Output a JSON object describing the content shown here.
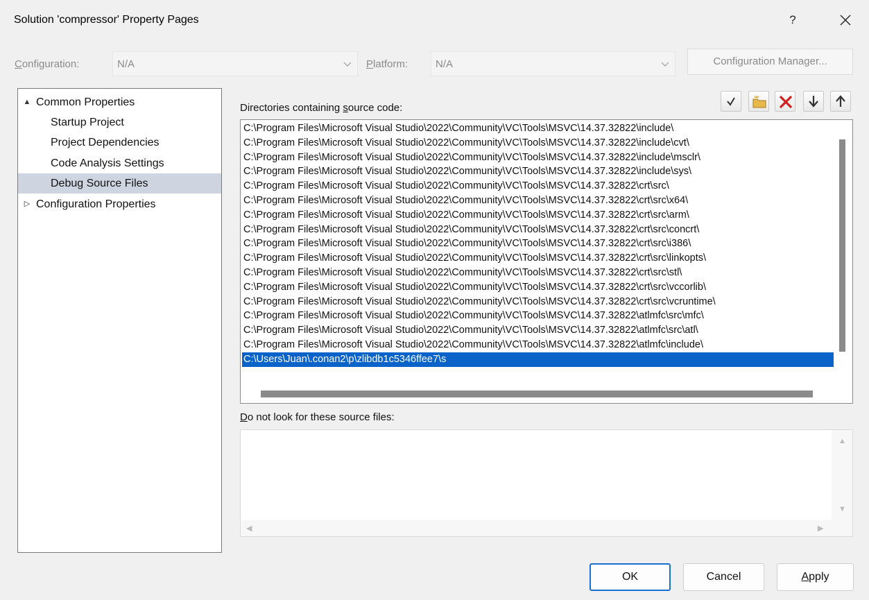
{
  "window": {
    "title": "Solution 'compressor' Property Pages",
    "help_glyph": "?",
    "close_icon": "close-icon"
  },
  "config_bar": {
    "configuration_label_first": "C",
    "configuration_label_rest": "onfiguration:",
    "configuration_value": "N/A",
    "platform_label_first": "P",
    "platform_label_rest": "latform:",
    "platform_value": "N/A",
    "configuration_manager_label": "Configuration Manager..."
  },
  "tree": {
    "items": [
      {
        "label": "Common Properties",
        "arrow": "▲",
        "expanded": true
      },
      {
        "label": "Startup Project"
      },
      {
        "label": "Project Dependencies"
      },
      {
        "label": "Code Analysis Settings"
      },
      {
        "label": "Debug Source Files",
        "selected": true
      },
      {
        "label": "Configuration Properties",
        "arrow": "▷",
        "expanded": false
      }
    ]
  },
  "source_dirs": {
    "label_before": "Directories containing ",
    "label_underlined": "s",
    "label_after": "ource code:",
    "toolbar_icons": [
      "checkmark-icon",
      "new-folder-icon",
      "delete-icon",
      "move-down-icon",
      "move-up-icon"
    ],
    "selected_index": 16,
    "entries": [
      "C:\\Program Files\\Microsoft Visual Studio\\2022\\Community\\VC\\Tools\\MSVC\\14.37.32822\\include\\",
      "C:\\Program Files\\Microsoft Visual Studio\\2022\\Community\\VC\\Tools\\MSVC\\14.37.32822\\include\\cvt\\",
      "C:\\Program Files\\Microsoft Visual Studio\\2022\\Community\\VC\\Tools\\MSVC\\14.37.32822\\include\\msclr\\",
      "C:\\Program Files\\Microsoft Visual Studio\\2022\\Community\\VC\\Tools\\MSVC\\14.37.32822\\include\\sys\\",
      "C:\\Program Files\\Microsoft Visual Studio\\2022\\Community\\VC\\Tools\\MSVC\\14.37.32822\\crt\\src\\",
      "C:\\Program Files\\Microsoft Visual Studio\\2022\\Community\\VC\\Tools\\MSVC\\14.37.32822\\crt\\src\\x64\\",
      "C:\\Program Files\\Microsoft Visual Studio\\2022\\Community\\VC\\Tools\\MSVC\\14.37.32822\\crt\\src\\arm\\",
      "C:\\Program Files\\Microsoft Visual Studio\\2022\\Community\\VC\\Tools\\MSVC\\14.37.32822\\crt\\src\\concrt\\",
      "C:\\Program Files\\Microsoft Visual Studio\\2022\\Community\\VC\\Tools\\MSVC\\14.37.32822\\crt\\src\\i386\\",
      "C:\\Program Files\\Microsoft Visual Studio\\2022\\Community\\VC\\Tools\\MSVC\\14.37.32822\\crt\\src\\linkopts\\",
      "C:\\Program Files\\Microsoft Visual Studio\\2022\\Community\\VC\\Tools\\MSVC\\14.37.32822\\crt\\src\\stl\\",
      "C:\\Program Files\\Microsoft Visual Studio\\2022\\Community\\VC\\Tools\\MSVC\\14.37.32822\\crt\\src\\vccorlib\\",
      "C:\\Program Files\\Microsoft Visual Studio\\2022\\Community\\VC\\Tools\\MSVC\\14.37.32822\\crt\\src\\vcruntime\\",
      "C:\\Program Files\\Microsoft Visual Studio\\2022\\Community\\VC\\Tools\\MSVC\\14.37.32822\\atlmfc\\src\\mfc\\",
      "C:\\Program Files\\Microsoft Visual Studio\\2022\\Community\\VC\\Tools\\MSVC\\14.37.32822\\atlmfc\\src\\atl\\",
      "C:\\Program Files\\Microsoft Visual Studio\\2022\\Community\\VC\\Tools\\MSVC\\14.37.32822\\atlmfc\\include\\",
      "C:\\Users\\Juan\\.conan2\\p\\zlibdb1c5346ffee7\\s"
    ]
  },
  "excluded_files": {
    "label_underlined": "D",
    "label_rest": "o not look for these source files:",
    "entries": []
  },
  "buttons": {
    "ok": "OK",
    "cancel": "Cancel",
    "apply_underlined": "A",
    "apply_rest": "pply"
  },
  "colors": {
    "selection": "#0a63c9",
    "tree_selection": "#cfd5e0",
    "default_button_border": "#1a6fd1",
    "delete_icon": "#d21f1f"
  }
}
